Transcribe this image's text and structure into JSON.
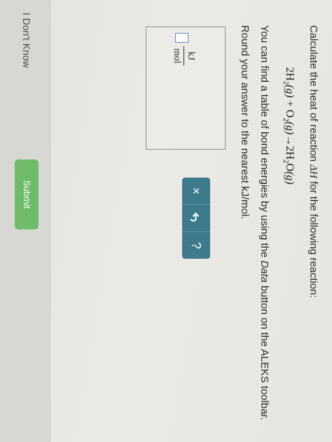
{
  "question": {
    "prefix": "Calculate the heat of reaction ",
    "delta_h": "ΔH",
    "suffix": " for the following reaction:"
  },
  "equation": {
    "coef_h2": "2",
    "h2": "H",
    "h2_sub": "2",
    "h2_state": "(g)",
    "plus": " + ",
    "o2": "O",
    "o2_sub": "2",
    "o2_state": "(g)",
    "arrow": "→",
    "coef_h2o": "2",
    "h2o_h": "H",
    "h2o_sub": "2",
    "h2o_o": "O",
    "h2o_state": "(g)"
  },
  "instruction": {
    "part1": "You can find a table of bond energies by using the ",
    "data_word": "Data",
    "part2": " button on the ALEKS toolbar."
  },
  "rounding": "Round your answer to the nearest kJ/mol.",
  "answer": {
    "value": "",
    "unit_numerator": "kJ",
    "unit_denominator": "mol"
  },
  "tools": {
    "clear": "×",
    "undo_icon": "undo-icon",
    "help": "?"
  },
  "footer": {
    "dont_know": "I Don't Know",
    "submit": "Submit"
  },
  "colors": {
    "tool_panel": "#3d7a8c",
    "submit_button": "#6dbb6b",
    "input_border": "#5b8ec4"
  }
}
